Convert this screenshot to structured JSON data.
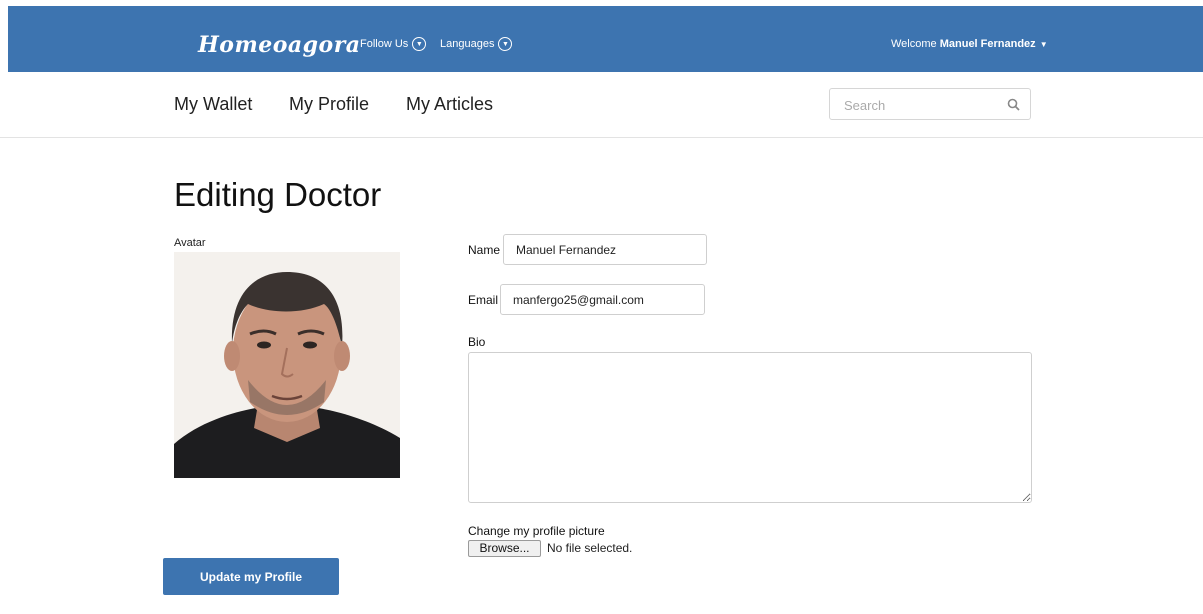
{
  "header": {
    "logo": "Homeoagora",
    "follow_label": "Follow Us",
    "languages_label": "Languages",
    "welcome_prefix": "Welcome",
    "user_name": "Manuel Fernandez",
    "bg_color": "#3d74b0"
  },
  "nav": {
    "items": [
      "My Wallet",
      "My Profile",
      "My Articles"
    ],
    "search_placeholder": "Search"
  },
  "page": {
    "title": "Editing Doctor",
    "avatar_label": "Avatar"
  },
  "form": {
    "name_label": "Name",
    "name_value": "Manuel Fernandez",
    "email_label": "Email",
    "email_value": "manfergo25@gmail.com",
    "bio_label": "Bio",
    "bio_value": "",
    "picture_label": "Change my profile picture",
    "browse_label": "Browse...",
    "no_file_text": "No file selected.",
    "submit_label": "Update my Profile"
  }
}
